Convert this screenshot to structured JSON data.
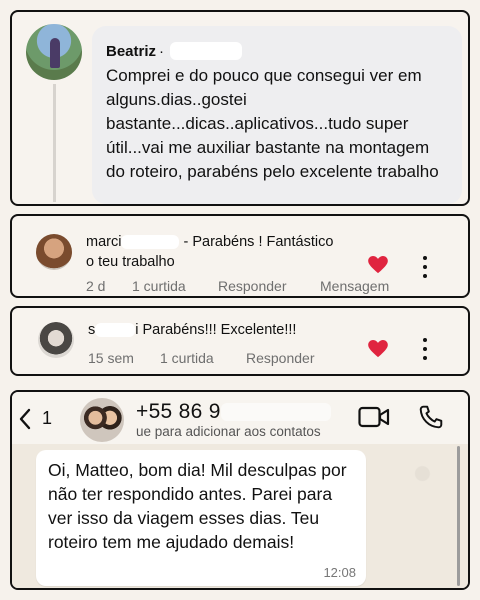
{
  "comment1": {
    "author": "Beatriz",
    "separator": "·",
    "text": "Comprei e do pouco que consegui ver em alguns.dias..gostei bastante...dicas..aplicativos...tudo super útil...vai me auxiliar bastante na montagem do roteiro, parabéns pelo excelente trabalho"
  },
  "comment2": {
    "author": "marci",
    "text_after_name": " - Parabéns ! Fantástico",
    "text_line2": "o teu trabalho",
    "time": "2 d",
    "likes": "1 curtida",
    "reply": "Responder",
    "message": "Mensagem",
    "heart_color": "#e0243f"
  },
  "comment3": {
    "author": "s",
    "text_after_name": "i Parabéns!!! Excelente!!!",
    "time": "15 sem",
    "likes": "1 curtida",
    "reply": "Responder",
    "heart_color": "#e0243f"
  },
  "whatsapp": {
    "back_glyph": "‹",
    "unread_count": "1",
    "phone": "+55 86 9",
    "subtitle": "ue para adicionar aos contatos",
    "message": "Oi, Matteo, bom dia! Mil desculpas por não ter respondido antes. Parei para ver isso da viagem esses dias. Teu roteiro tem me ajudado demais!",
    "time": "12:08"
  },
  "icons": {
    "heart": "heart-icon",
    "kebab": "more-options-icon",
    "video": "video-call-icon",
    "call": "phone-call-icon",
    "back": "back-arrow-icon"
  }
}
